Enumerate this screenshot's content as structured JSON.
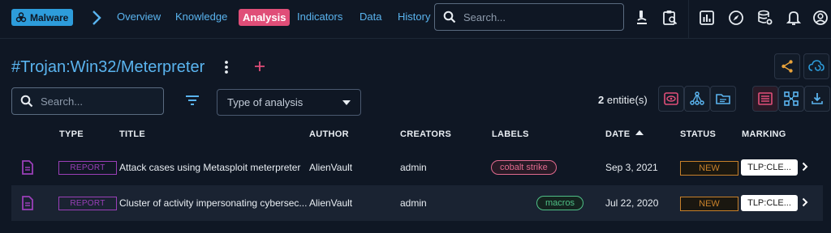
{
  "topbar": {
    "entity_type": "Malware",
    "nav": [
      "Overview",
      "Knowledge",
      "Analysis",
      "Indicators",
      "Data",
      "History"
    ],
    "active_nav": "Analysis",
    "search_placeholder": "Search..."
  },
  "entity": {
    "title": "#Trojan:Win32/Meterpreter"
  },
  "filters": {
    "search_placeholder": "Search...",
    "type_select": "Type of analysis",
    "count_number": "2",
    "count_label": " entitie(s)"
  },
  "table": {
    "headers": {
      "type": "TYPE",
      "title": "TITLE",
      "author": "AUTHOR",
      "creators": "CREATORS",
      "labels": "LABELS",
      "date": "DATE",
      "status": "STATUS",
      "marking": "MARKING"
    },
    "rows": [
      {
        "type": "REPORT",
        "title": "Attack cases using Metasploit meterpreter",
        "author": "AlienVault",
        "creators": "admin",
        "label": "cobalt strike",
        "date": "Sep 3, 2021",
        "status": "NEW",
        "marking": "TLP:CLE..."
      },
      {
        "type": "REPORT",
        "title": "Cluster of activity impersonating cybersec...",
        "author": "AlienVault",
        "creators": "admin",
        "label": "macros",
        "date": "Jul 22, 2020",
        "status": "NEW",
        "marking": "TLP:CLE..."
      }
    ]
  },
  "colors": {
    "accent": "#5ab4ef",
    "active": "#e04e78",
    "report": "#9a3fb8",
    "status_new": "#c7802a",
    "label_cobalt": "#e06a8e",
    "label_macros": "#4fbf86"
  }
}
